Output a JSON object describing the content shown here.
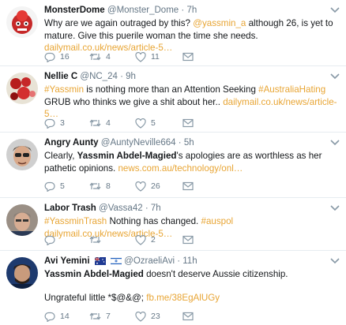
{
  "tweets": [
    {
      "name": "MonsterDome",
      "handle": "@Monster_Dome",
      "time": "7h",
      "text1": "Why are we again outraged by this? ",
      "mention": "@yassmin_a",
      "text2": " although 26, is yet to mature. Give this puerile woman the time she needs. ",
      "link": "dailymail.co.uk/news/article-5…",
      "replies": "16",
      "retweets": "4",
      "likes": "11"
    },
    {
      "name": "Nellie C",
      "handle": "@NC_24",
      "time": "9h",
      "hashtag1": "#Yassmin",
      "text1": " is nothing more than an Attention Seeking ",
      "hashtag2": "#AustraliaHating",
      "text2": " GRUB who thinks we give a shit about her.. ",
      "link": "dailymail.co.uk/news/article-5…",
      "replies": "3",
      "retweets": "4",
      "likes": "5"
    },
    {
      "name": "Angry Aunty",
      "handle": "@AuntyNeville664",
      "time": "5h",
      "text1": "Clearly, ",
      "bold": "Yassmin Abdel-Magied",
      "text2": "'s apologies are as worthless as her pathetic opinions. ",
      "link": "news.com.au/technology/onl…",
      "replies": "5",
      "retweets": "8",
      "likes": "26"
    },
    {
      "name": "Labor Trash",
      "handle": "@Vassa42",
      "time": "7h",
      "hashtag1": "#YassminTrash",
      "text1": " Nothing has changed. ",
      "hashtag2": "#auspol",
      "link": "dailymail.co.uk/news/article-5…",
      "replies": "",
      "retweets": "",
      "likes": "2"
    },
    {
      "name": "Avi Yemini",
      "handle": "@OzraeliAvi",
      "time": "11h",
      "bold": "Yassmin Abdel-Magied",
      "text1": " doesn't deserve Aussie citizenship.",
      "text2": "Ungrateful little *$@&@; ",
      "link": "fb.me/38EgAlUGy",
      "replies": "14",
      "retweets": "7",
      "likes": "23"
    }
  ],
  "colors": {
    "link": "#e8a534",
    "meta": "#657786",
    "divider": "#e6ecf0"
  },
  "icons": {
    "reply": "reply-icon",
    "retweet": "retweet-icon",
    "like": "heart-icon",
    "dm": "envelope-icon",
    "more": "chevron-down-icon"
  }
}
